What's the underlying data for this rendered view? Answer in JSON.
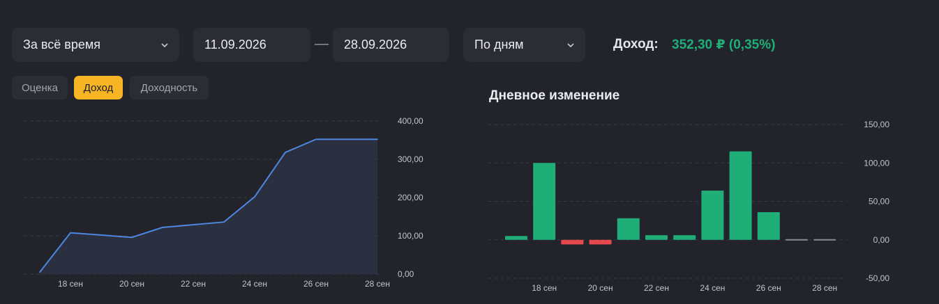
{
  "filters": {
    "period": "За всё время",
    "date_from": "11.09.2026",
    "date_sep": "—",
    "date_to": "28.09.2026",
    "grouping": "По дням"
  },
  "summary": {
    "label": "Доход:",
    "value": "352,30 ₽ (0,35%)",
    "value_color": "#1fae78"
  },
  "tabs": [
    {
      "label": "Оценка",
      "active": false
    },
    {
      "label": "Доход",
      "active": true
    },
    {
      "label": "Доходность",
      "active": false
    }
  ],
  "right_title": "Дневное изменение",
  "chart_data": [
    {
      "type": "area",
      "x": [
        "17 сен",
        "18 сен",
        "19 сен",
        "20 сен",
        "21 сен",
        "22 сен",
        "23 сен",
        "24 сен",
        "25 сен",
        "26 сен",
        "27 сен",
        "28 сен"
      ],
      "values": [
        5,
        108,
        102,
        96,
        122,
        129,
        136,
        202,
        318,
        352.3,
        352.3,
        352.3
      ],
      "xticks": [
        "18 сен",
        "20 сен",
        "22 сен",
        "24 сен",
        "26 сен",
        "28 сен"
      ],
      "yticks": [
        "0,00",
        "100,00",
        "200,00",
        "300,00",
        "400,00"
      ],
      "ylim": [
        0,
        400
      ],
      "grid": true,
      "color": "#4f86e0"
    },
    {
      "type": "bar",
      "title": "Дневное изменение",
      "categories": [
        "17 сен",
        "18 сен",
        "19 сен",
        "20 сен",
        "21 сен",
        "22 сен",
        "23 сен",
        "24 сен",
        "25 сен",
        "26 сен",
        "27 сен",
        "28 сен"
      ],
      "values": [
        5,
        100,
        -6,
        -6,
        28,
        6,
        6,
        64,
        115,
        36,
        0,
        0
      ],
      "xticks": [
        "18 сен",
        "20 сен",
        "22 сен",
        "24 сен",
        "26 сен",
        "28 сен"
      ],
      "yticks": [
        "-50,00",
        "0,00",
        "50,00",
        "100,00",
        "150,00"
      ],
      "ylim": [
        -50,
        150
      ],
      "grid": true,
      "colors": {
        "positive": "#1fae78",
        "negative": "#e5484d",
        "zero": "#8a8a92"
      }
    }
  ]
}
